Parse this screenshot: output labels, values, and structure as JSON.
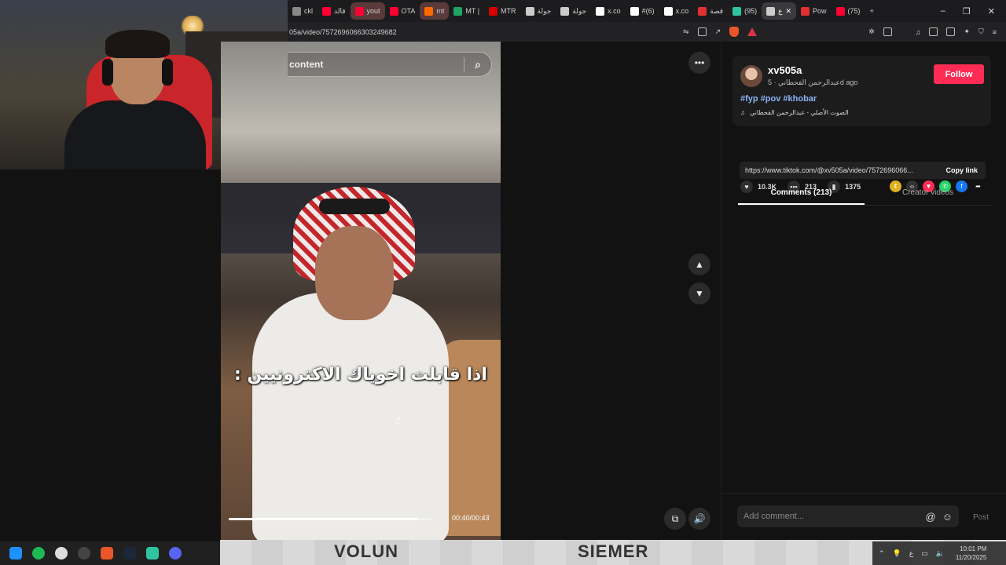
{
  "browser": {
    "tabs": [
      {
        "label": "ckl",
        "color": "#888888",
        "active": false
      },
      {
        "label": "قالد",
        "color": "#ff0033",
        "active": false
      },
      {
        "label": "yout",
        "color": "#ff0033",
        "active": false,
        "highlight": true
      },
      {
        "label": "OTA",
        "color": "#ff0033",
        "active": false
      },
      {
        "label": "mt",
        "color": "#ff6a00",
        "active": false,
        "highlight": true
      },
      {
        "label": "MT |",
        "color": "#1fa463",
        "active": false
      },
      {
        "label": "MTR",
        "color": "#d40000",
        "active": false
      },
      {
        "label": "جولة",
        "color": "#cccccc",
        "active": false
      },
      {
        "label": "جولة",
        "color": "#cccccc",
        "active": false
      },
      {
        "label": "x.co",
        "color": "#ffffff",
        "active": false
      },
      {
        "label": "#(6)",
        "color": "#ffffff",
        "active": false
      },
      {
        "label": "x.co",
        "color": "#ffffff",
        "active": false
      },
      {
        "label": "قصة",
        "color": "#e03030",
        "active": false
      },
      {
        "label": "(95)",
        "color": "#2ec4a0",
        "active": false
      },
      {
        "label": "ع",
        "color": "#cccccc",
        "active": true
      },
      {
        "label": "Pow",
        "color": "#e03030",
        "active": false
      },
      {
        "label": "(75)",
        "color": "#ff0033",
        "active": false
      }
    ],
    "new_tab": "+",
    "window_controls": [
      "–",
      "❐",
      "✕"
    ],
    "url": "05a/video/7572696066303249682"
  },
  "search": {
    "placeholder": "content",
    "icon": "search-icon"
  },
  "video": {
    "caption": "اذا قابلت اخوياك الاكترونيين :",
    "time": "00:40/00:43",
    "progress": 0.93
  },
  "controls": {
    "more": "•••",
    "prev": "⌃",
    "next": "⌄"
  },
  "post": {
    "username": "xv505a",
    "display_name": "عبدالرحمن القحطاني",
    "age": "5d ago",
    "follow_label": "Follow",
    "hashtags": "#fyp #pov #khobar",
    "music": "الصوت الأصلي - عبدالرحمن القحطاني",
    "likes": "10.3K",
    "comments": "213",
    "saves": "1375",
    "link": "https://www.tiktok.com/@xv505a/video/7572696066...",
    "copy_label": "Copy link"
  },
  "panel_tabs": {
    "comments": "Comments (213)",
    "creator": "Creator videos"
  },
  "comment_box": {
    "placeholder": "Add comment...",
    "post_label": "Post"
  },
  "overlay_strip": {
    "left_text": "VOLUN",
    "right_text": "SIEMER"
  },
  "taskbar": {
    "time": "10:01 PM",
    "date": "11/20/2025",
    "lang": "ع"
  },
  "colors": {
    "follow": "#fe2c55",
    "hashtag": "#8ab4f8"
  }
}
